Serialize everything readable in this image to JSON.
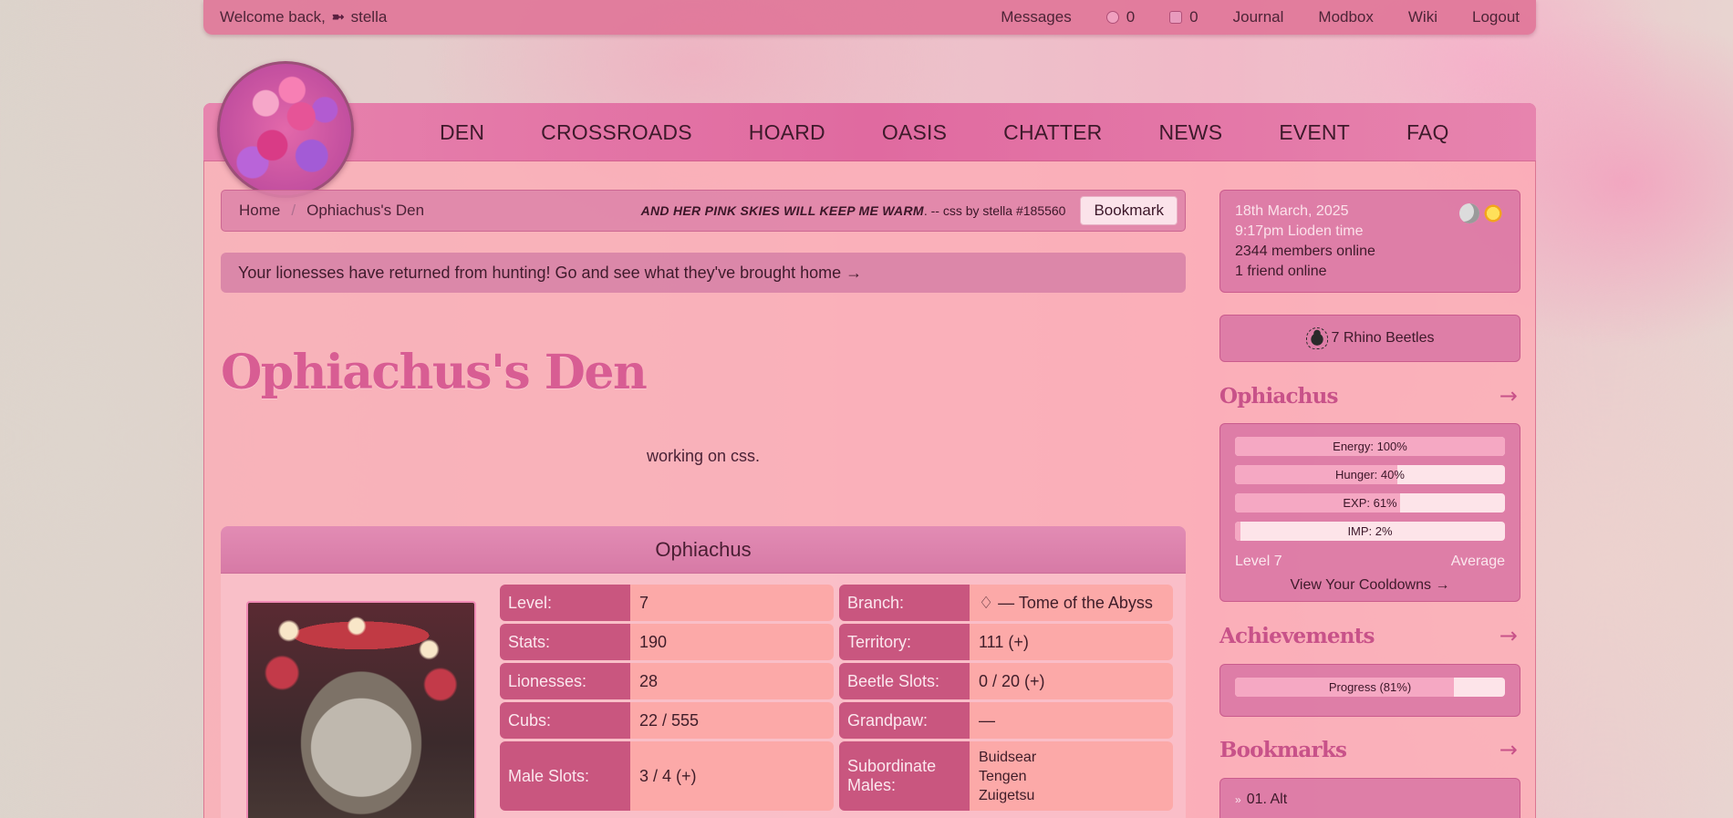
{
  "topbar": {
    "welcome_prefix": "Welcome back,",
    "arrow": "➼",
    "username": "stella",
    "messages": "Messages",
    "count_a": "0",
    "count_b": "0",
    "journal": "Journal",
    "modbox": "Modbox",
    "wiki": "Wiki",
    "logout": "Logout"
  },
  "nav": [
    "DEN",
    "CROSSROADS",
    "HOARD",
    "OASIS",
    "CHATTER",
    "NEWS",
    "EVENT",
    "FAQ"
  ],
  "breadcrumb": {
    "home": "Home",
    "sep": "/",
    "current": "Ophiachus's Den",
    "quote_bold": "AND HER PINK SKIES WILL KEEP ME WARM",
    "quote_rest": ". -- css by stella #185560",
    "bookmark": "Bookmark"
  },
  "notice": "Your lionesses have returned from hunting! Go and see what they've brought home →",
  "den": {
    "title": "Ophiachus's Den",
    "description": "working on css."
  },
  "lion": {
    "name": "Ophiachus",
    "rows": [
      [
        {
          "k": "Level:",
          "v": "7"
        },
        {
          "k": "Branch:",
          "v": "♢ — Tome of the Abyss"
        }
      ],
      [
        {
          "k": "Stats:",
          "v": "190"
        },
        {
          "k": "Territory:",
          "v": "111 (+)"
        }
      ],
      [
        {
          "k": "Lionesses:",
          "v": "28"
        },
        {
          "k": "Beetle Slots:",
          "v": "0 / 20 (+)"
        }
      ],
      [
        {
          "k": "Cubs:",
          "v": "22 / 555"
        },
        {
          "k": "Grandpaw:",
          "v": "—"
        }
      ]
    ],
    "male_slots_label": "Male Slots:",
    "male_slots_value": "3 / 4 (+)",
    "sub_label": "Subordinate Males:",
    "sub_males": [
      "Buidsear",
      "Tengen",
      "Zuigetsu"
    ]
  },
  "sidebar": {
    "date": "18th March, 2025",
    "time": "9:17pm Lioden time",
    "members": "2344 members online",
    "friends": "1 friend online",
    "beetles": "7 Rhino Beetles",
    "lion_heading": "Ophiachus",
    "go": "→",
    "bars": [
      {
        "label": "Energy: 100%",
        "value": 100
      },
      {
        "label": "Hunger: 40%",
        "value": 60
      },
      {
        "label": "EXP: 61%",
        "value": 61
      },
      {
        "label": "IMP: 2%",
        "value": 2
      }
    ],
    "level": "Level 7",
    "rank": "Average",
    "cooldowns": "View Your Cooldowns →",
    "ach_heading": "Achievements",
    "progress_label": "Progress (81%)",
    "progress_value": 81,
    "bm_heading": "Bookmarks",
    "bookmarks": [
      "01. Alt"
    ],
    "bullet": "»"
  }
}
